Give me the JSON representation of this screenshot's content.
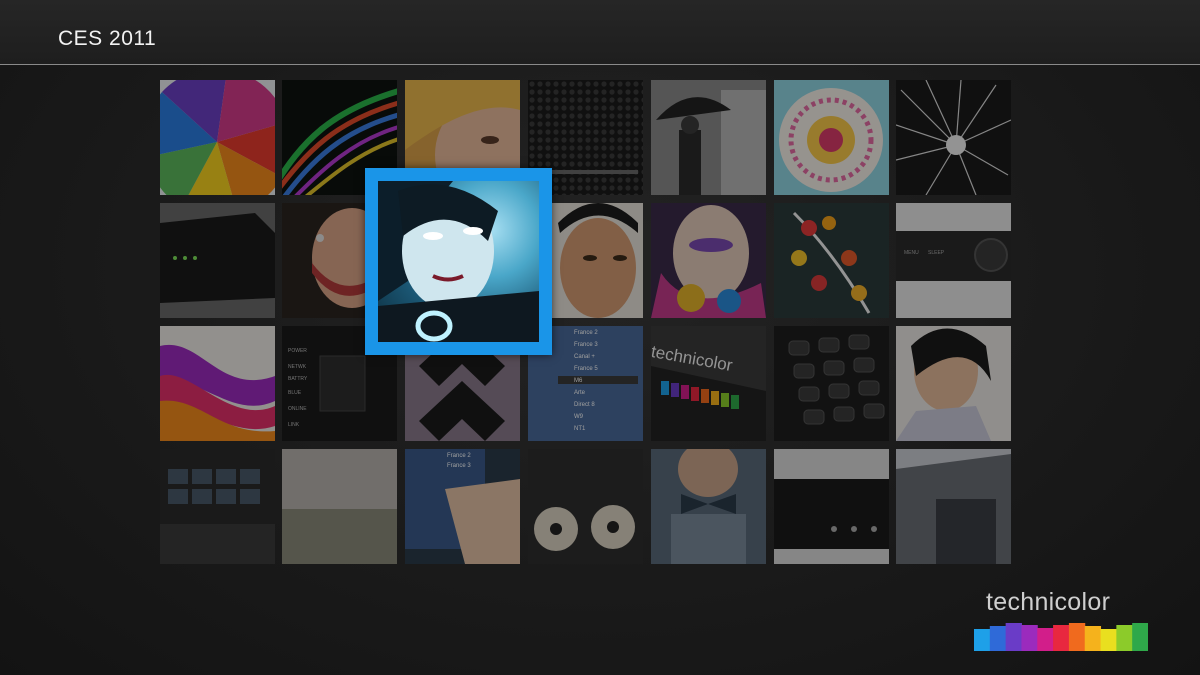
{
  "header": {
    "title": "CES 2011"
  },
  "tiles": {
    "r3c4": {
      "channels": [
        "France 2",
        "France 3",
        "Canal +",
        "France 5",
        "M6",
        "Arte",
        "Direct 8",
        "W9",
        "NT1"
      ]
    },
    "r3c5": {
      "brand_text": "technicolor"
    },
    "r2c7": {
      "button_left": "MENU",
      "button_right": "SLEEP"
    },
    "r3c2": {
      "labels": [
        "POWER",
        "NETWK",
        "BATTRY",
        "BLUE",
        "ONLINE",
        "LINK"
      ]
    },
    "r4c3": {
      "menu_items": [
        "France 2",
        "France 3"
      ]
    }
  },
  "logo": {
    "text": "technicolor",
    "colors": [
      "#1ea0e8",
      "#2f6ad8",
      "#6a3cc7",
      "#9b2bbd",
      "#d21e8a",
      "#e8283f",
      "#f06a1e",
      "#f5b21c",
      "#e9df1f",
      "#8ccb2a",
      "#2fa84a"
    ]
  },
  "colors": {
    "selection": "#1a95e8"
  }
}
